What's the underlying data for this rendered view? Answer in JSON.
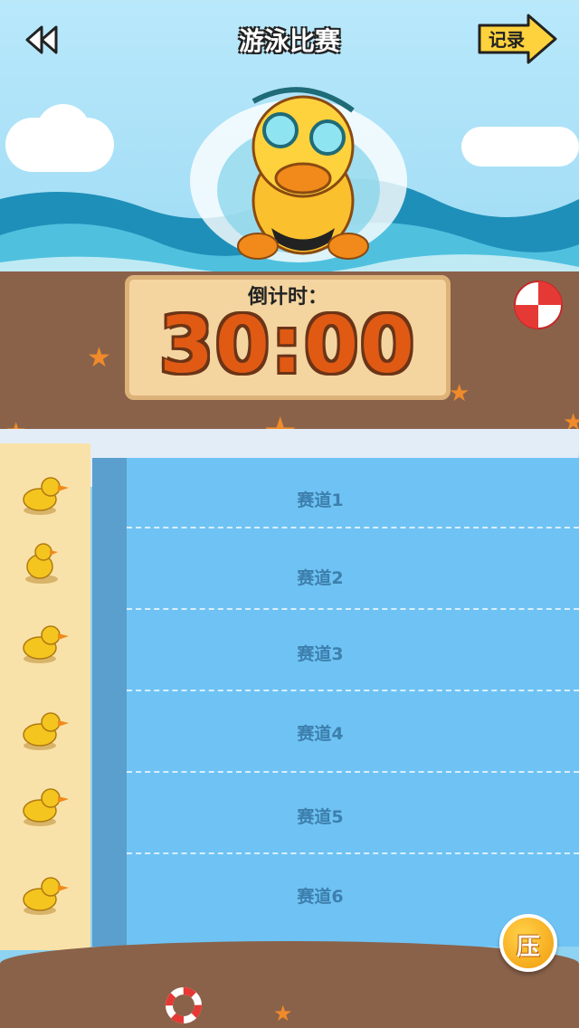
{
  "header": {
    "title": "游泳比赛",
    "back_icon": "double-chevron-left-icon",
    "record_label": "记录"
  },
  "timer": {
    "label": "倒计时：",
    "value": "30:00"
  },
  "lanes": [
    {
      "label": "赛道1"
    },
    {
      "label": "赛道2"
    },
    {
      "label": "赛道3"
    },
    {
      "label": "赛道4"
    },
    {
      "label": "赛道5"
    },
    {
      "label": "赛道6"
    }
  ],
  "press_button": {
    "label": "压"
  },
  "colors": {
    "sky": "#b9e8fb",
    "water": "#6ec3f4",
    "sand": "#8a624a",
    "timer_text": "#e05a14",
    "accent_button": "#f29a0b"
  }
}
